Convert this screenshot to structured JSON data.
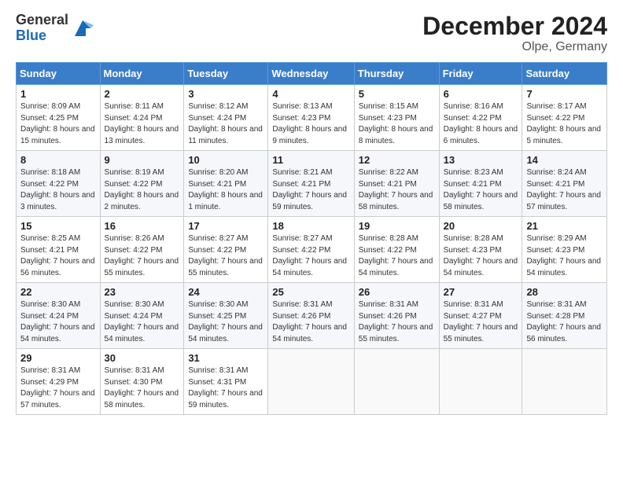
{
  "logo": {
    "general": "General",
    "blue": "Blue"
  },
  "header": {
    "month_year": "December 2024",
    "location": "Olpe, Germany"
  },
  "days_of_week": [
    "Sunday",
    "Monday",
    "Tuesday",
    "Wednesday",
    "Thursday",
    "Friday",
    "Saturday"
  ],
  "weeks": [
    [
      {
        "day": "1",
        "sunrise": "8:09 AM",
        "sunset": "4:25 PM",
        "daylight": "8 hours and 15 minutes."
      },
      {
        "day": "2",
        "sunrise": "8:11 AM",
        "sunset": "4:24 PM",
        "daylight": "8 hours and 13 minutes."
      },
      {
        "day": "3",
        "sunrise": "8:12 AM",
        "sunset": "4:24 PM",
        "daylight": "8 hours and 11 minutes."
      },
      {
        "day": "4",
        "sunrise": "8:13 AM",
        "sunset": "4:23 PM",
        "daylight": "8 hours and 9 minutes."
      },
      {
        "day": "5",
        "sunrise": "8:15 AM",
        "sunset": "4:23 PM",
        "daylight": "8 hours and 8 minutes."
      },
      {
        "day": "6",
        "sunrise": "8:16 AM",
        "sunset": "4:22 PM",
        "daylight": "8 hours and 6 minutes."
      },
      {
        "day": "7",
        "sunrise": "8:17 AM",
        "sunset": "4:22 PM",
        "daylight": "8 hours and 5 minutes."
      }
    ],
    [
      {
        "day": "8",
        "sunrise": "8:18 AM",
        "sunset": "4:22 PM",
        "daylight": "8 hours and 3 minutes."
      },
      {
        "day": "9",
        "sunrise": "8:19 AM",
        "sunset": "4:22 PM",
        "daylight": "8 hours and 2 minutes."
      },
      {
        "day": "10",
        "sunrise": "8:20 AM",
        "sunset": "4:21 PM",
        "daylight": "8 hours and 1 minute."
      },
      {
        "day": "11",
        "sunrise": "8:21 AM",
        "sunset": "4:21 PM",
        "daylight": "7 hours and 59 minutes."
      },
      {
        "day": "12",
        "sunrise": "8:22 AM",
        "sunset": "4:21 PM",
        "daylight": "7 hours and 58 minutes."
      },
      {
        "day": "13",
        "sunrise": "8:23 AM",
        "sunset": "4:21 PM",
        "daylight": "7 hours and 58 minutes."
      },
      {
        "day": "14",
        "sunrise": "8:24 AM",
        "sunset": "4:21 PM",
        "daylight": "7 hours and 57 minutes."
      }
    ],
    [
      {
        "day": "15",
        "sunrise": "8:25 AM",
        "sunset": "4:21 PM",
        "daylight": "7 hours and 56 minutes."
      },
      {
        "day": "16",
        "sunrise": "8:26 AM",
        "sunset": "4:22 PM",
        "daylight": "7 hours and 55 minutes."
      },
      {
        "day": "17",
        "sunrise": "8:27 AM",
        "sunset": "4:22 PM",
        "daylight": "7 hours and 55 minutes."
      },
      {
        "day": "18",
        "sunrise": "8:27 AM",
        "sunset": "4:22 PM",
        "daylight": "7 hours and 54 minutes."
      },
      {
        "day": "19",
        "sunrise": "8:28 AM",
        "sunset": "4:22 PM",
        "daylight": "7 hours and 54 minutes."
      },
      {
        "day": "20",
        "sunrise": "8:28 AM",
        "sunset": "4:23 PM",
        "daylight": "7 hours and 54 minutes."
      },
      {
        "day": "21",
        "sunrise": "8:29 AM",
        "sunset": "4:23 PM",
        "daylight": "7 hours and 54 minutes."
      }
    ],
    [
      {
        "day": "22",
        "sunrise": "8:30 AM",
        "sunset": "4:24 PM",
        "daylight": "7 hours and 54 minutes."
      },
      {
        "day": "23",
        "sunrise": "8:30 AM",
        "sunset": "4:24 PM",
        "daylight": "7 hours and 54 minutes."
      },
      {
        "day": "24",
        "sunrise": "8:30 AM",
        "sunset": "4:25 PM",
        "daylight": "7 hours and 54 minutes."
      },
      {
        "day": "25",
        "sunrise": "8:31 AM",
        "sunset": "4:26 PM",
        "daylight": "7 hours and 54 minutes."
      },
      {
        "day": "26",
        "sunrise": "8:31 AM",
        "sunset": "4:26 PM",
        "daylight": "7 hours and 55 minutes."
      },
      {
        "day": "27",
        "sunrise": "8:31 AM",
        "sunset": "4:27 PM",
        "daylight": "7 hours and 55 minutes."
      },
      {
        "day": "28",
        "sunrise": "8:31 AM",
        "sunset": "4:28 PM",
        "daylight": "7 hours and 56 minutes."
      }
    ],
    [
      {
        "day": "29",
        "sunrise": "8:31 AM",
        "sunset": "4:29 PM",
        "daylight": "7 hours and 57 minutes."
      },
      {
        "day": "30",
        "sunrise": "8:31 AM",
        "sunset": "4:30 PM",
        "daylight": "7 hours and 58 minutes."
      },
      {
        "day": "31",
        "sunrise": "8:31 AM",
        "sunset": "4:31 PM",
        "daylight": "7 hours and 59 minutes."
      },
      null,
      null,
      null,
      null
    ]
  ],
  "labels": {
    "sunrise": "Sunrise:",
    "sunset": "Sunset:",
    "daylight": "Daylight:"
  }
}
